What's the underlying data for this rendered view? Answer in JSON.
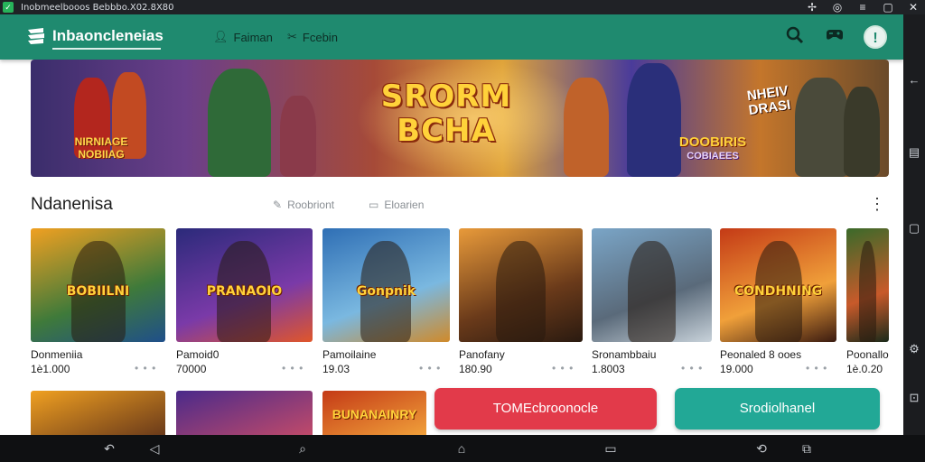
{
  "window": {
    "title": "Inobmeelbooos  Bebbbo.X02.8X80",
    "controls": [
      "pin-icon",
      "target-icon",
      "menu-icon",
      "restore-icon",
      "close-icon"
    ]
  },
  "header": {
    "brand": "Inbaoncleneias",
    "nav": [
      {
        "label": "Faiman",
        "icon": "person-icon"
      },
      {
        "label": "Fcebin",
        "icon": "tools-icon"
      }
    ],
    "search_icon": "search-icon",
    "controller_icon": "gamepad-icon",
    "help_label": "!"
  },
  "banner": {
    "title_line1": "SRORM",
    "title_line2": "BCHA",
    "left_text_line1": "NIRNIAGE",
    "left_text_line2": "NOBIIAG",
    "right_text_line1": "NHEIV",
    "right_text_line2": "DRASI",
    "right_sub": "DOOBIRIS",
    "right_sub2": "COBIAEES"
  },
  "section": {
    "title": "Ndanenisa",
    "link1": "Roobriont",
    "link2": "Eloarien",
    "more": "⋮"
  },
  "games": [
    {
      "name": "Donmeniia",
      "count": "1è1.000",
      "thumb_text": "BOBIILNI",
      "colors": [
        "#f0a021",
        "#3f7a3a",
        "#1f4f8a"
      ]
    },
    {
      "name": "Pamoid0",
      "count": "70000",
      "thumb_text": "PRANAOIO",
      "colors": [
        "#2b2a7a",
        "#7a3aa8",
        "#e0562a"
      ]
    },
    {
      "name": "Pamoilaine",
      "count": "19.03",
      "thumb_text": "Gonpnik",
      "colors": [
        "#2f6fb5",
        "#7ab8e0",
        "#d08a2a"
      ]
    },
    {
      "name": "Panofany",
      "count": "180.90",
      "thumb_text": "",
      "colors": [
        "#e89a3a",
        "#6a3a1a",
        "#2a1a10"
      ]
    },
    {
      "name": "Sronambbaiu",
      "count": "1.8003",
      "thumb_text": "",
      "colors": [
        "#7aa5c7",
        "#5a6a7a",
        "#c8d2da"
      ]
    },
    {
      "name": "Peonaled 8 ooes",
      "count": "19.000",
      "thumb_text": "CONDHNING",
      "colors": [
        "#c43a16",
        "#f0a03a",
        "#3a1a10"
      ]
    },
    {
      "name": "Poonallo",
      "count": "1è.0.20",
      "thumb_text": "",
      "colors": [
        "#3a6a2a",
        "#c85a2a",
        "#1a2a1a"
      ]
    }
  ],
  "bottom_row": {
    "thumb3_text": "BUNANAINRY"
  },
  "buttons": {
    "primary": "TOMEcbroonocle",
    "secondary": "Srodiolhanel"
  },
  "colors": {
    "header": "#1f8a6f",
    "primary_button": "#e23a4a",
    "secondary_button": "#22a896"
  },
  "navbar": [
    "back-icon",
    "volume-icon",
    "screen-icon",
    "home-icon",
    "recents-icon",
    "rotate-icon",
    "multi-window-icon"
  ]
}
